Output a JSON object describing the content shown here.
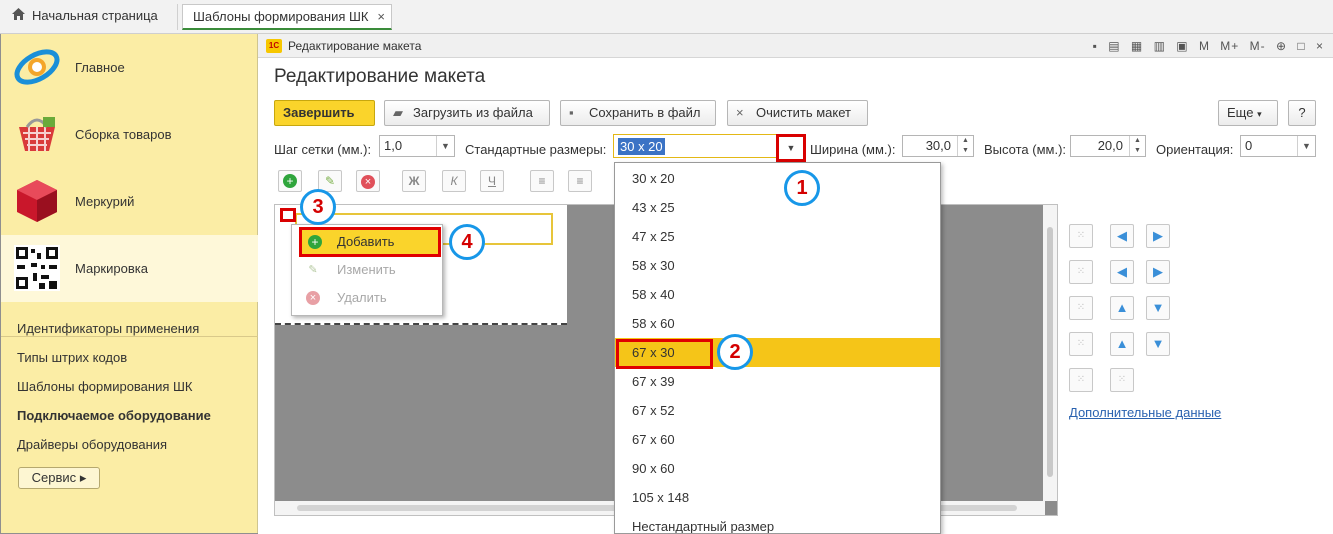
{
  "tabs": {
    "home": "Начальная страница",
    "active": "Шаблоны формирования ШК",
    "close_glyph": "×"
  },
  "sidebar": {
    "sections": [
      {
        "label": "Главное",
        "icon": "orbit-logo-icon"
      },
      {
        "label": "Сборка товаров",
        "icon": "basket-icon"
      },
      {
        "label": "Меркурий",
        "icon": "red-cube-icon"
      },
      {
        "label": "Маркировка",
        "icon": "qr-code-icon"
      }
    ],
    "links": [
      {
        "label": "Идентификаторы применения",
        "bold": false
      },
      {
        "label": "Типы штрих кодов",
        "bold": false
      },
      {
        "label": "Шаблоны формирования ШК",
        "bold": false
      },
      {
        "label": "Подключаемое оборудование",
        "bold": true
      },
      {
        "label": "Драйверы оборудования",
        "bold": false
      }
    ],
    "service_label": "Сервис"
  },
  "window": {
    "title": "Редактирование макета",
    "logo_text": "1С",
    "heading": "Редактирование макета",
    "buttons": {
      "finish": "Завершить",
      "load": "Загрузить из файла",
      "save": "Сохранить в файл",
      "clear": "Очистить макет",
      "more": "Еще",
      "help": "?"
    },
    "fields": {
      "grid_label": "Шаг сетки (мм.):",
      "grid_value": "1,0",
      "std_label": "Стандартные размеры:",
      "std_value": "30 x 20",
      "width_label": "Ширина (мм.):",
      "width_value": "30,0",
      "height_label": "Высота (мм.):",
      "height_value": "20,0",
      "orient_label": "Ориентация:",
      "orient_value": "0"
    },
    "format_tools": [
      "Ж",
      "К",
      "Ч"
    ],
    "context_menu": {
      "add": "Добавить",
      "edit": "Изменить",
      "delete": "Удалить"
    },
    "dropdown_options": [
      "30 x 20",
      "43 x 25",
      "47 x 25",
      "58 x 30",
      "58 x 40",
      "58 x 60",
      "67 x 30",
      "67 x 39",
      "67 x 52",
      "67 x 60",
      "90 x 60",
      "105 x 148",
      "Нестандартный размер"
    ],
    "highlighted_option": "67 x 30",
    "more_data_link": "Дополнительные данные"
  },
  "badges": [
    "1",
    "2",
    "3",
    "4"
  ],
  "colors": {
    "sidebar_bg": "#fbeda5",
    "accent_yellow": "#fad42b",
    "highlight_red": "#e00000",
    "badge_blue": "#1797e8",
    "selection_blue": "#3b73c5",
    "canvas_gray": "#8c8c8c"
  }
}
